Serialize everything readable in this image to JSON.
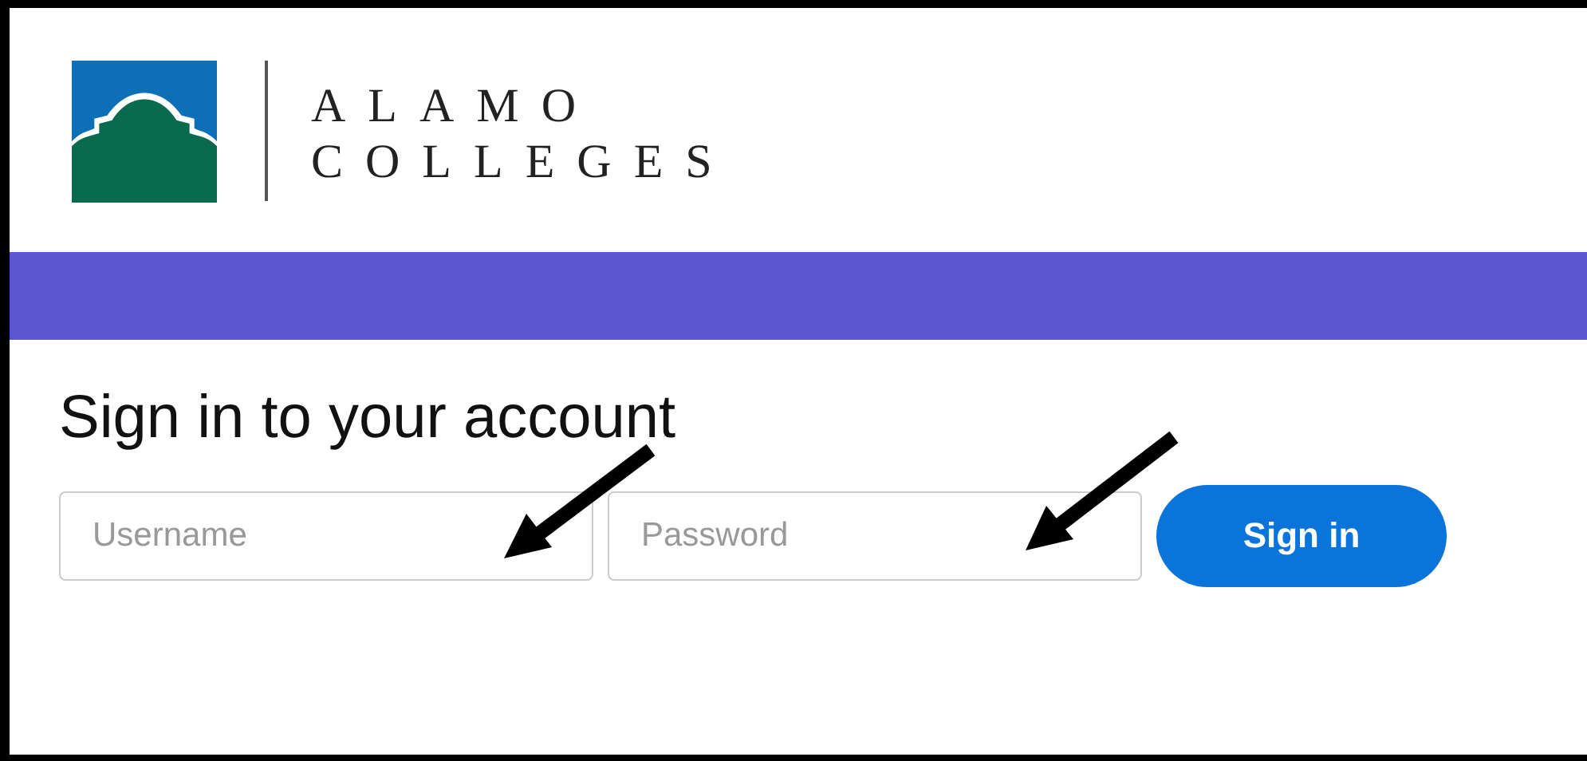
{
  "logo": {
    "line_1": "ALAMO",
    "line_2": "COLLEGES"
  },
  "heading": "Sign in to your account",
  "form": {
    "username": {
      "placeholder": "Username"
    },
    "password": {
      "placeholder": "Password"
    },
    "submit": "Sign in"
  }
}
